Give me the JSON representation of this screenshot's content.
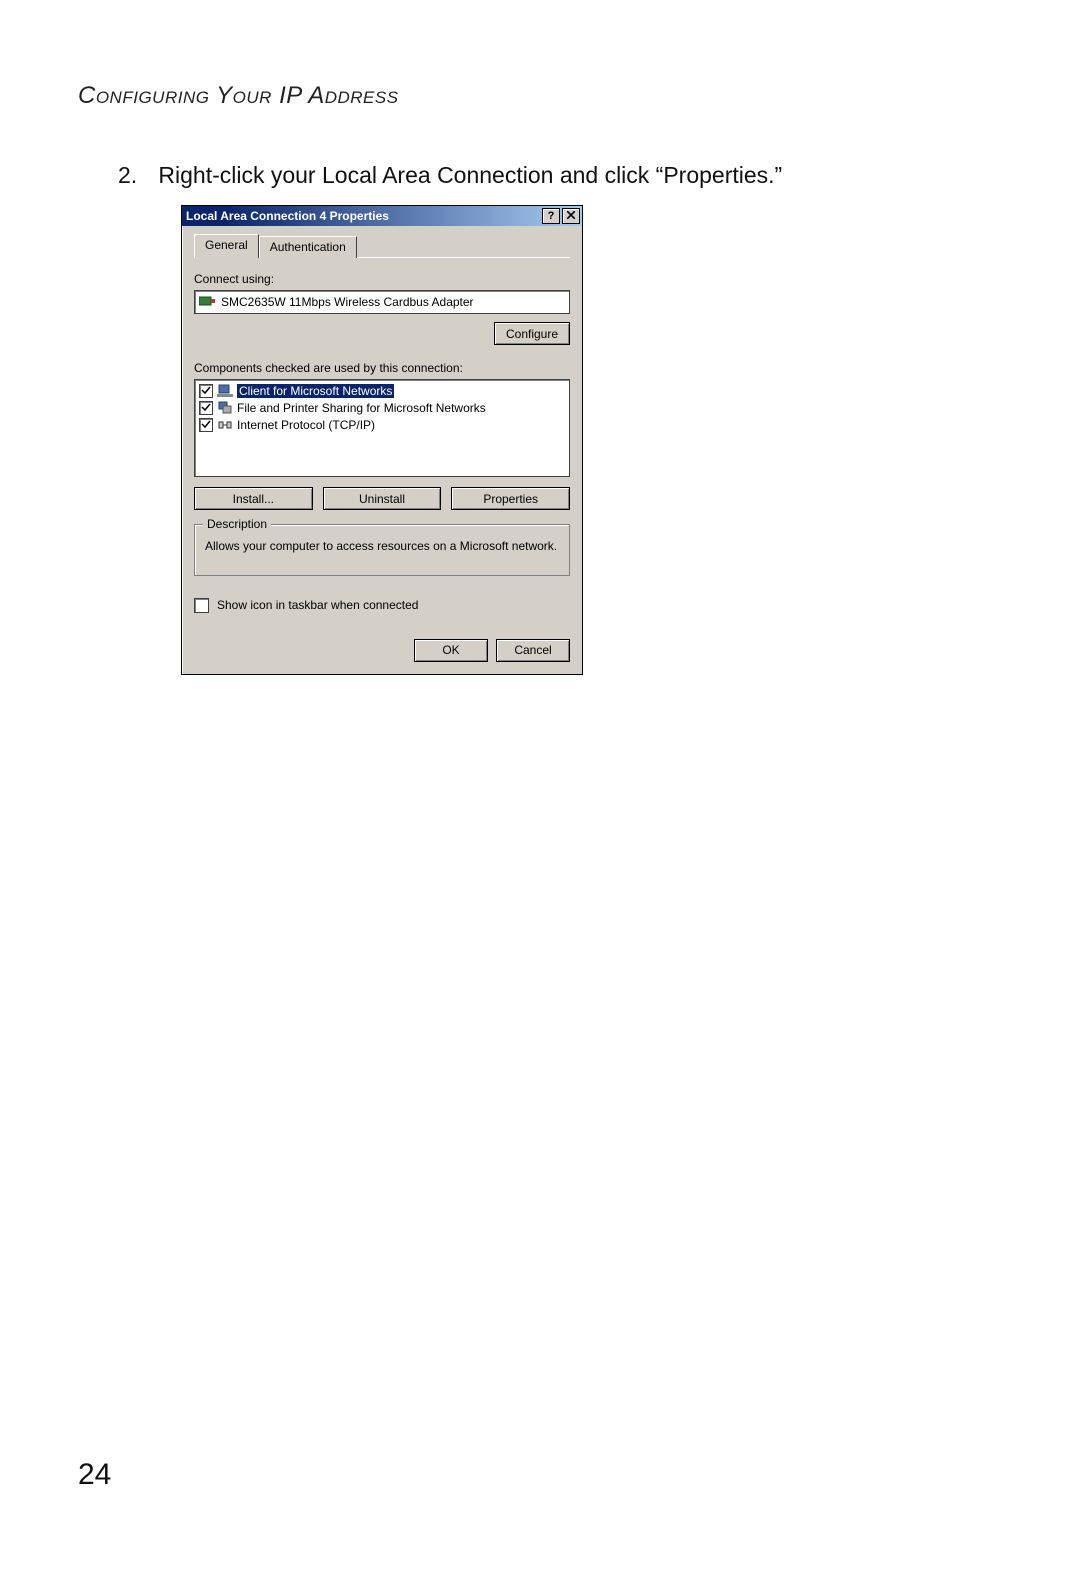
{
  "doc": {
    "section_title": "Configuring Your IP Address",
    "step_number": "2.",
    "step_text": "Right-click your Local Area Connection and click “Properties.”",
    "page_number": "24"
  },
  "dialog": {
    "title": "Local Area Connection 4 Properties",
    "help_symbol": "?",
    "tabs": {
      "general": "General",
      "authentication": "Authentication"
    },
    "connect_using_label": "Connect using:",
    "adapter_name": "SMC2635W 11Mbps Wireless Cardbus Adapter",
    "configure_button": "Configure",
    "components_label": "Components checked are used by this connection:",
    "components": [
      {
        "label": "Client for Microsoft Networks",
        "checked": true,
        "selected": true,
        "icon": "client"
      },
      {
        "label": "File and Printer Sharing for Microsoft Networks",
        "checked": true,
        "selected": false,
        "icon": "share"
      },
      {
        "label": "Internet Protocol (TCP/IP)",
        "checked": true,
        "selected": false,
        "icon": "protocol"
      }
    ],
    "buttons": {
      "install": "Install...",
      "uninstall": "Uninstall",
      "properties": "Properties"
    },
    "description": {
      "legend": "Description",
      "text": "Allows your computer to access resources on a Microsoft network."
    },
    "show_icon_label": "Show icon in taskbar when connected",
    "show_icon_checked": false,
    "footer": {
      "ok": "OK",
      "cancel": "Cancel"
    }
  }
}
